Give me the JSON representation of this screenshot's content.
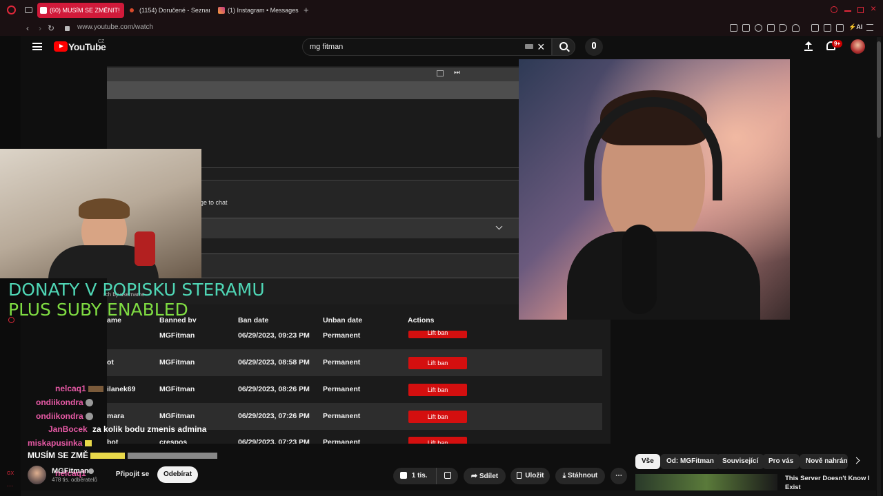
{
  "browser": {
    "tabs": [
      {
        "label": "(60) MUSÍM SE ZMĚNIT!",
        "color": "#ff0033"
      },
      {
        "label": "(1154) Doručené - Seznam",
        "color": "#d94a2b"
      },
      {
        "label": "(1) Instagram • Messages",
        "color": "#c13584"
      }
    ],
    "url": "www.youtube.com/watch"
  },
  "youtube": {
    "logo_text": "YouTube",
    "country": "CZ",
    "search_value": "mg fitman",
    "notifications_badge": "9+"
  },
  "stream_overlay": {
    "line1": "DONATY V POPISKU STERAMU",
    "line2": "PLUS SUBY ENABLED"
  },
  "screenshare": {
    "partial_label": "ge to chat",
    "search_placeholder": "rch by username",
    "columns": [
      "ame",
      "Banned by",
      "Ban date",
      "Unban date",
      "Actions"
    ],
    "rows": [
      {
        "name": "",
        "banned_by": "MGFitman",
        "ban_date": "06/29/2023, 09:23 PM",
        "unban": "Permanent",
        "action": "Lift ban"
      },
      {
        "name": "ot",
        "banned_by": "MGFitman",
        "ban_date": "06/29/2023, 08:58 PM",
        "unban": "Permanent",
        "action": "Lift ban"
      },
      {
        "name": "ilanek69",
        "banned_by": "MGFitman",
        "ban_date": "06/29/2023, 08:26 PM",
        "unban": "Permanent",
        "action": "Lift ban"
      },
      {
        "name": "mara",
        "banned_by": "MGFitman",
        "ban_date": "06/29/2023, 07:26 PM",
        "unban": "Permanent",
        "action": "Lift ban"
      },
      {
        "name": "bot",
        "banned_by": "crespos",
        "ban_date": "06/29/2023, 07:23 PM",
        "unban": "Permanent",
        "action": "Lift ban"
      }
    ]
  },
  "chat": [
    {
      "user": "nelcaq1",
      "msg": "",
      "color": "#e85aa6"
    },
    {
      "user": "ondiikondra",
      "msg": "",
      "color": "#e85aa6"
    },
    {
      "user": "ondiikondra",
      "msg": "",
      "color": "#e85aa6"
    },
    {
      "user": "JanBocek",
      "msg": "za kolik bodu zmenis admina",
      "color": "#e85aa6"
    },
    {
      "user": "miskapusinka",
      "msg": "",
      "color": "#e85aa6"
    },
    {
      "user": "MUSÍM SE ZMĚ",
      "msg": "",
      "color": "#ffffff"
    },
    {
      "user": "nelcaq1",
      "msg": "",
      "color": "#e85aa6"
    }
  ],
  "channel": {
    "name": "MGFitman",
    "subscribers": "478 tis. odběratelů",
    "join_label": "Připojit se",
    "subscribe_label": "Odebírat"
  },
  "actions": {
    "likes": "1 tis.",
    "share": "Sdílet",
    "save": "Uložit",
    "download": "Stáhnout"
  },
  "chips": [
    "Vše",
    "Od: MGFitman",
    "Související",
    "Pro vás",
    "Nově nahráno"
  ],
  "recommended": {
    "title": "This Server Doesn't Know I Exist"
  }
}
